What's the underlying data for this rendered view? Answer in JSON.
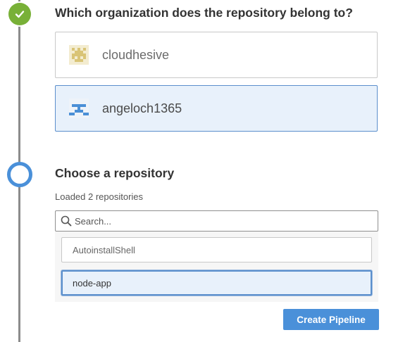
{
  "steps": {
    "organization": {
      "status": "completed",
      "heading": "Which organization does the repository belong to?",
      "organizations": [
        {
          "name": "cloudhesive",
          "avatar_color": "#e2d18c",
          "selected": false
        },
        {
          "name": "angeloch1365",
          "avatar_color": "#4a90d9",
          "selected": true
        }
      ]
    },
    "repository": {
      "status": "current",
      "heading": "Choose a repository",
      "loaded_text": "Loaded 2 repositories",
      "search": {
        "placeholder": "Search...",
        "value": ""
      },
      "repositories": [
        {
          "name": "AutoinstallShell",
          "selected": false
        },
        {
          "name": "node-app",
          "selected": true
        }
      ]
    }
  },
  "actions": {
    "create_pipeline_label": "Create Pipeline"
  },
  "icons": {
    "step_done": "check-icon",
    "step_current": "ring-icon",
    "search": "search-icon"
  },
  "colors": {
    "completed_green": "#78b037",
    "accent_blue": "#4a90d9",
    "selected_bg": "#e8f1fb",
    "timeline_gray": "#8c8c8c"
  }
}
